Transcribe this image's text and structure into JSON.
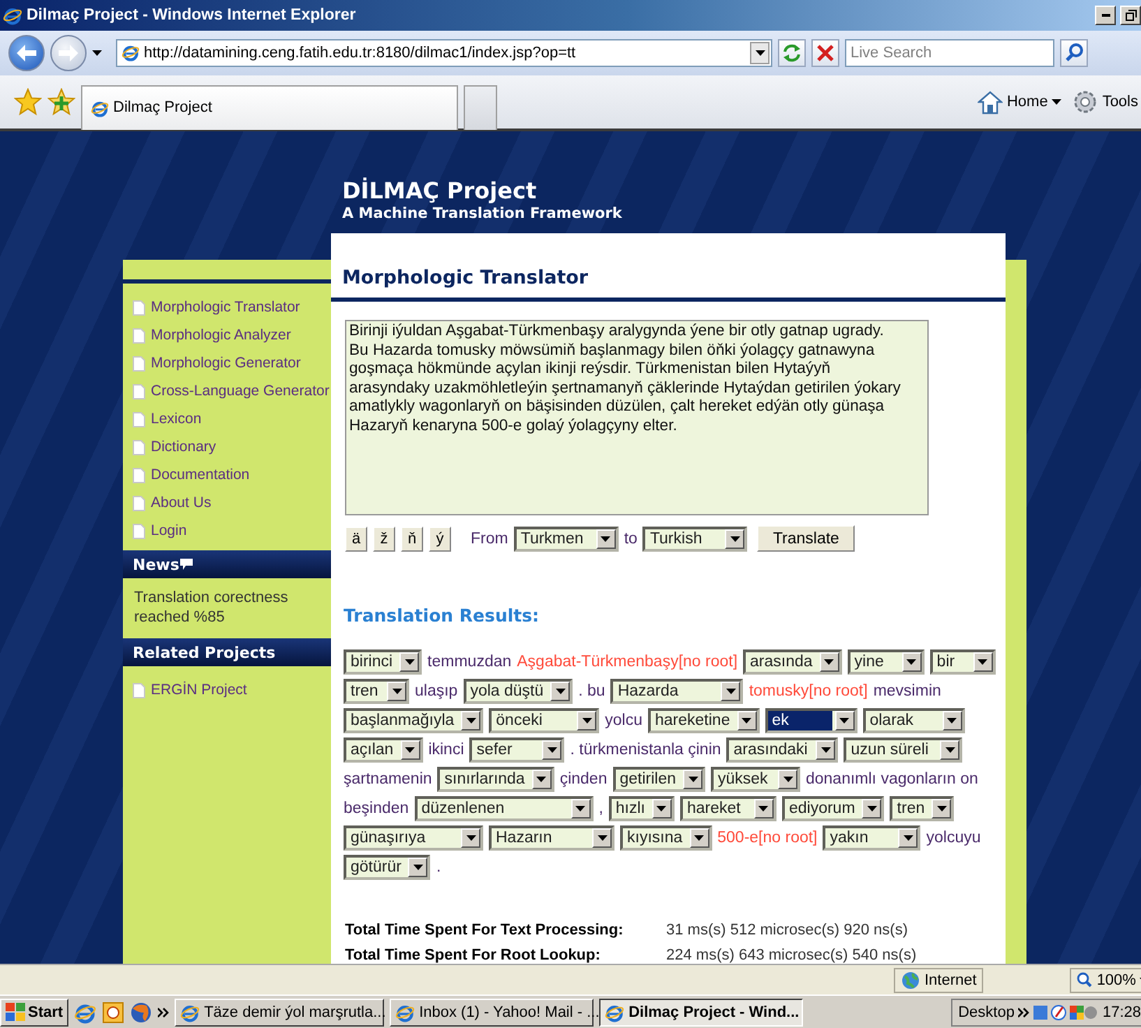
{
  "window": {
    "title": "Dilmaç Project - Windows Internet Explorer"
  },
  "address_bar": {
    "url": "http://datamining.ceng.fatih.edu.tr:8180/dilmac1/index.jsp?op=tt",
    "search_placeholder": "Live Search"
  },
  "tabs": [
    {
      "label": "Dilmaç Project",
      "selected": true
    }
  ],
  "toolbar": [
    "Home",
    "Tools"
  ],
  "site": {
    "title": "DİLMAÇ Project",
    "subtitle": "A Machine Translation Framework"
  },
  "sidebar": {
    "menu": [
      "Morphologic Translator",
      "Morphologic Analyzer",
      "Morphologic Generator",
      "Cross-Language Generator",
      "Lexicon",
      "Dictionary",
      "Documentation",
      "About Us",
      "Login"
    ],
    "news": {
      "heading": "News",
      "text": "Translation corectness reached %85"
    },
    "related": {
      "heading": "Related Projects",
      "items": [
        "ERGİN Project"
      ]
    }
  },
  "translator": {
    "heading": "Morphologic Translator",
    "input": "Birinji iýuldan Aşgabat-Türkmenbaşy aralygynda ýene bir otly gatnap ugrady.\nBu Hazarda tomusky möwsümiň başlanmagy bilen öňki ýolagçy gatnawyna\ngoşmaça hökmünde açylan ikinji reýsdir. Türkmenistan bilen Hytaýyň\narasyndaky uzakmöhletleýin şertnamanyň çäklerinde Hytaýdan getirilen ýokary\namatlykly wagonlaryň on bäşisinden düzülen, çalt hereket edýän otly günaşa\nHazaryň kenaryna 500-e golaý ýolagçyny elter.",
    "char_buttons": [
      "ä",
      "ž",
      "ň",
      "ý"
    ],
    "from_label": "From",
    "from": "Turkmen",
    "to_label": "to",
    "to": "Turkish",
    "button": "Translate"
  },
  "results": {
    "heading": "Translation Results:",
    "tokens": [
      {
        "kind": "select",
        "value": "birinci",
        "selected": false
      },
      {
        "kind": "word",
        "text": "temmuzdan"
      },
      {
        "kind": "unknown",
        "text": "Aşgabat-Türkmenbaşy[no root]"
      },
      {
        "kind": "select",
        "value": "arasında",
        "selected": false
      },
      {
        "kind": "select",
        "value": "yine",
        "selected": false
      },
      {
        "kind": "select",
        "value": "bir",
        "selected": false
      },
      {
        "kind": "select",
        "value": "tren",
        "selected": false
      },
      {
        "kind": "word",
        "text": "ulaşıp"
      },
      {
        "kind": "select",
        "value": "yola düştü",
        "selected": false
      },
      {
        "kind": "word",
        "text": ". bu"
      },
      {
        "kind": "select",
        "value": "Hazarda",
        "selected": false
      },
      {
        "kind": "unknown",
        "text": "tomusky[no root]"
      },
      {
        "kind": "word",
        "text": "mevsimin"
      },
      {
        "kind": "select",
        "value": "başlanmağıyla",
        "selected": false
      },
      {
        "kind": "select",
        "value": "önceki",
        "selected": false
      },
      {
        "kind": "word",
        "text": "yolcu"
      },
      {
        "kind": "select",
        "value": "hareketine",
        "selected": false
      },
      {
        "kind": "select",
        "value": "ek",
        "selected": true
      },
      {
        "kind": "select",
        "value": "olarak",
        "selected": false
      },
      {
        "kind": "select",
        "value": "açılan",
        "selected": false
      },
      {
        "kind": "word",
        "text": "ikinci"
      },
      {
        "kind": "select",
        "value": "sefer",
        "selected": false
      },
      {
        "kind": "word",
        "text": ". türkmenistanla çinin"
      },
      {
        "kind": "select",
        "value": "arasındaki",
        "selected": false
      },
      {
        "kind": "select",
        "value": "uzun süreli",
        "selected": false
      },
      {
        "kind": "word",
        "text": "şartnamenin"
      },
      {
        "kind": "select",
        "value": "sınırlarında",
        "selected": false
      },
      {
        "kind": "word",
        "text": "çinden"
      },
      {
        "kind": "select",
        "value": "getirilen",
        "selected": false
      },
      {
        "kind": "select",
        "value": "yüksek",
        "selected": false
      },
      {
        "kind": "word",
        "text": "donanımlı vagonların on"
      },
      {
        "kind": "word",
        "text": "beşinden"
      },
      {
        "kind": "select",
        "value": "düzenlenen",
        "selected": false
      },
      {
        "kind": "word",
        "text": ","
      },
      {
        "kind": "select",
        "value": "hızlı",
        "selected": false
      },
      {
        "kind": "select",
        "value": "hareket",
        "selected": false
      },
      {
        "kind": "select",
        "value": "ediyorum",
        "selected": false
      },
      {
        "kind": "select",
        "value": "tren",
        "selected": false
      },
      {
        "kind": "select",
        "value": "günaşırıya",
        "selected": false
      },
      {
        "kind": "select",
        "value": "Hazarın",
        "selected": false
      },
      {
        "kind": "select",
        "value": "kıyısına",
        "selected": false
      },
      {
        "kind": "unknown",
        "text": "500-e[no root]"
      },
      {
        "kind": "select",
        "value": "yakın",
        "selected": false
      },
      {
        "kind": "word",
        "text": "yolcuyu"
      },
      {
        "kind": "select",
        "value": "götürür",
        "selected": false
      },
      {
        "kind": "word",
        "text": "."
      }
    ]
  },
  "timings": [
    {
      "label": "Total Time Spent For Text Processing:",
      "value": "31 ms(s) 512 microsec(s) 920 ns(s)"
    },
    {
      "label": "Total Time Spent For Root Lookup:",
      "value": "224 ms(s) 643 microsec(s) 540 ns(s)"
    }
  ],
  "status_bar": {
    "zone": "Internet",
    "zoom": "100%"
  },
  "taskbar": {
    "start": "Start",
    "tasks": [
      {
        "label": "Täze demir ýol marşrutla...",
        "selected": false
      },
      {
        "label": "Inbox (1) - Yahoo! Mail - ...",
        "selected": false
      },
      {
        "label": "Dilmaç Project - Wind...",
        "selected": true
      }
    ],
    "desktop": "Desktop",
    "clock": "17:28"
  }
}
